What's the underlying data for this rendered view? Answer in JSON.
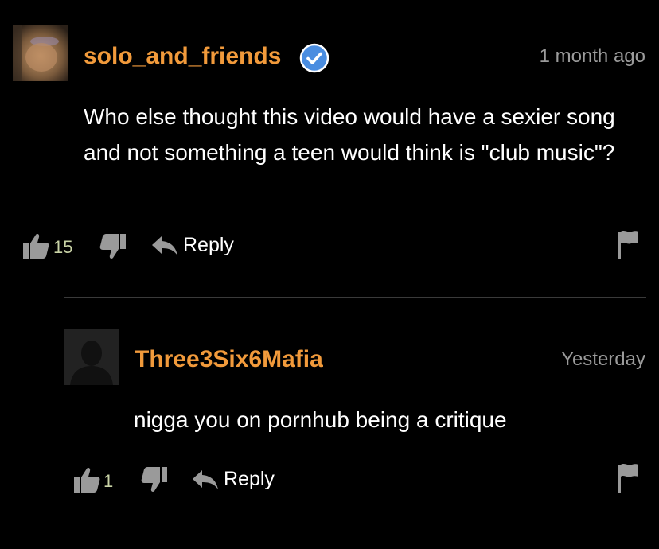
{
  "comments": [
    {
      "username": "solo_and_friends",
      "verified": true,
      "time": "1 month ago",
      "text": "Who else thought this video would have a sexier song and not something a teen would think is \"club music\"?",
      "likes": "15",
      "reply_label": "Reply"
    },
    {
      "username": "Three3Six6Mafia",
      "verified": false,
      "time": "Yesterday",
      "text": "nigga you on pornhub being a critique",
      "likes": "1",
      "reply_label": "Reply"
    }
  ],
  "colors": {
    "background": "#000000",
    "username": "#f19a3b",
    "timestamp": "#9b9b9b",
    "text": "#ffffff",
    "verified_badge": "#4a8de0",
    "icons": "#9a9a9a"
  },
  "icons": {
    "like": "thumbs-up-icon",
    "dislike": "thumbs-down-icon",
    "reply": "reply-arrow-icon",
    "flag": "flag-icon",
    "verified": "verified-check-icon"
  }
}
